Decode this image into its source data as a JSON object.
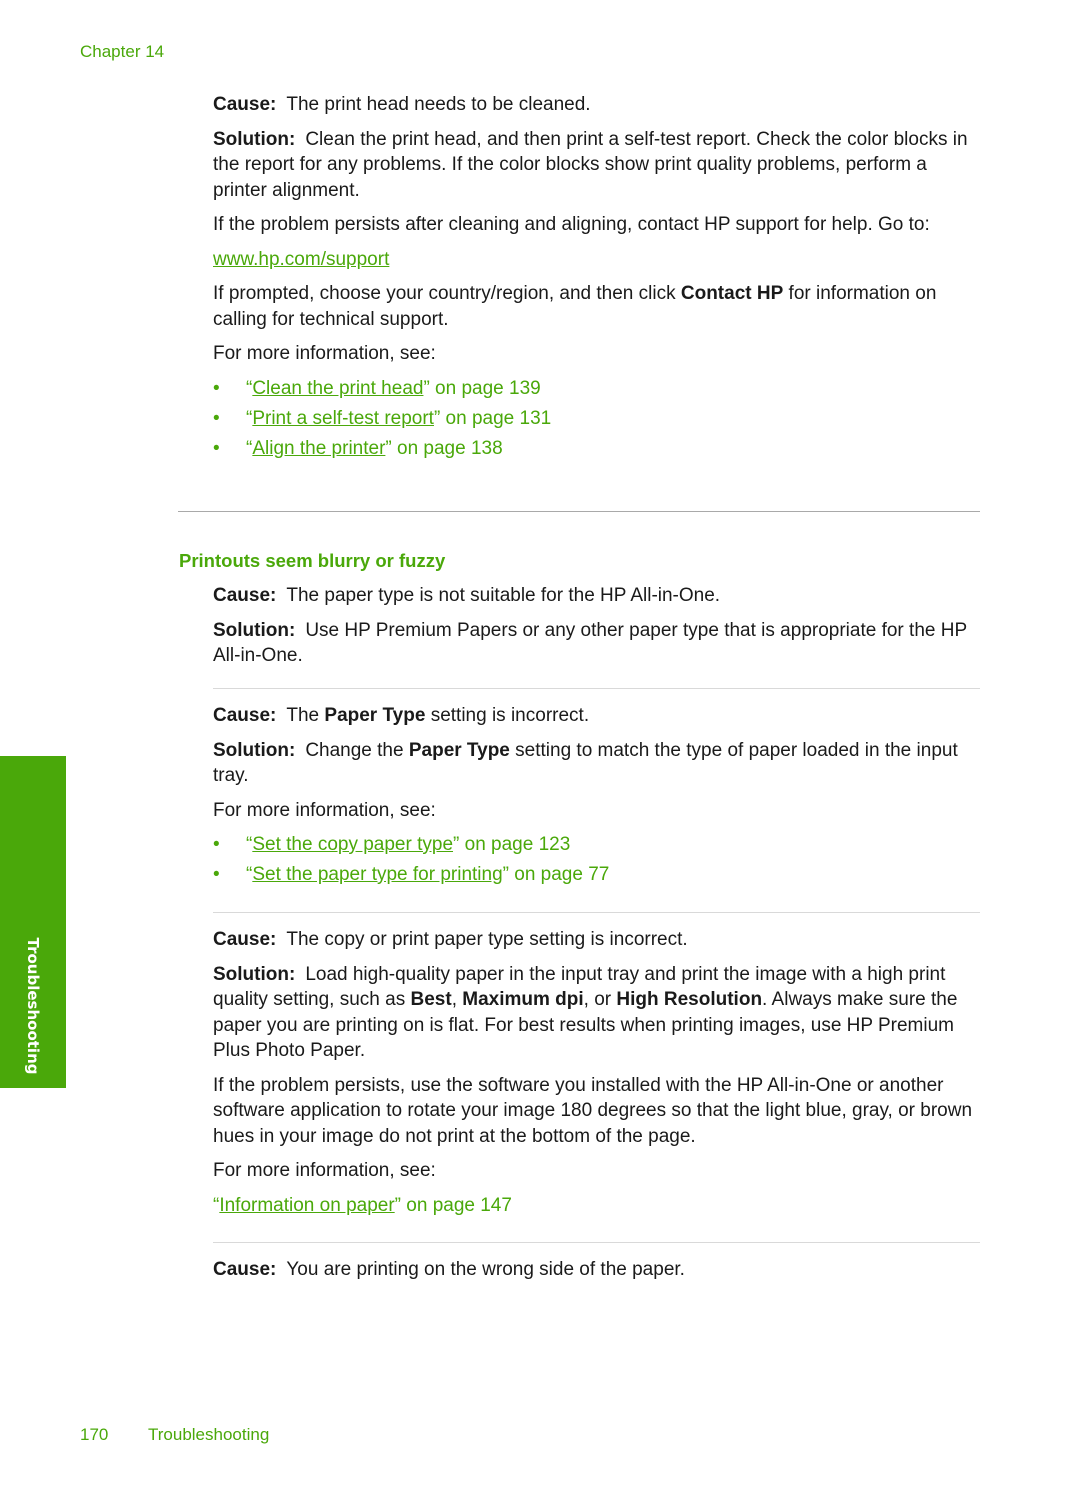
{
  "header": {
    "chapter": "Chapter 14"
  },
  "side_tab": {
    "label": "Troubleshooting"
  },
  "section1": {
    "cause_label": "Cause:",
    "cause_text": "The print head needs to be cleaned.",
    "solution_label": "Solution:",
    "solution_text": "Clean the print head, and then print a self-test report. Check the color blocks in the report for any problems. If the color blocks show print quality problems, perform a printer alignment.",
    "persist_text": "If the problem persists after cleaning and aligning, contact HP support for help. Go to:",
    "support_link": "www.hp.com/support",
    "prompt_pre": "If prompted, choose your country/region, and then click ",
    "prompt_bold": "Contact HP",
    "prompt_post": " for information on calling for technical support.",
    "more_info": "For more information, see:",
    "links": [
      {
        "open": "“",
        "text": "Clean the print head",
        "suffix": "” on page 139"
      },
      {
        "open": "“",
        "text": "Print a self-test report",
        "suffix": "” on page 131"
      },
      {
        "open": "“",
        "text": "Align the printer",
        "suffix": "” on page 138"
      }
    ],
    "bullet": "•"
  },
  "section2": {
    "heading": "Printouts seem blurry or fuzzy",
    "block1": {
      "cause_label": "Cause:",
      "cause_text": "The paper type is not suitable for the HP All-in-One.",
      "solution_label": "Solution:",
      "solution_text": "Use HP Premium Papers or any other paper type that is appropriate for the HP All-in-One."
    },
    "block2": {
      "cause_label": "Cause:",
      "cause_pre": "The ",
      "cause_bold": "Paper Type",
      "cause_post": " setting is incorrect.",
      "solution_label": "Solution:",
      "solution_pre": "Change the ",
      "solution_bold": "Paper Type",
      "solution_post": " setting to match the type of paper loaded in the input tray.",
      "more_info": "For more information, see:",
      "links": [
        {
          "open": "“",
          "text": "Set the copy paper type",
          "suffix": "” on page 123"
        },
        {
          "open": "“",
          "text": "Set the paper type for printing",
          "suffix": "” on page 77"
        }
      ]
    },
    "block3": {
      "cause_label": "Cause:",
      "cause_text": "The copy or print paper type setting is incorrect.",
      "solution_label": "Solution:",
      "solution_a": "Load high-quality paper in the input tray and print the image with a high print quality setting, such as ",
      "bold1": "Best",
      "sep1": ", ",
      "bold2": "Maximum dpi",
      "sep2": ", or ",
      "bold3": "High Resolution",
      "solution_b": ". Always make sure the paper you are printing on is flat. For best results when printing images, use HP Premium Plus Photo Paper.",
      "persist_text": "If the problem persists, use the software you installed with the HP All-in-One or another software application to rotate your image 180 degrees so that the light blue, gray, or brown hues in your image do not print at the bottom of the page.",
      "more_info": "For more information, see:",
      "link": {
        "open": "“",
        "text": "Information on paper",
        "suffix": "” on page 147"
      }
    },
    "block4": {
      "cause_label": "Cause:",
      "cause_text": "You are printing on the wrong side of the paper."
    }
  },
  "footer": {
    "page_number": "170",
    "section": "Troubleshooting"
  }
}
